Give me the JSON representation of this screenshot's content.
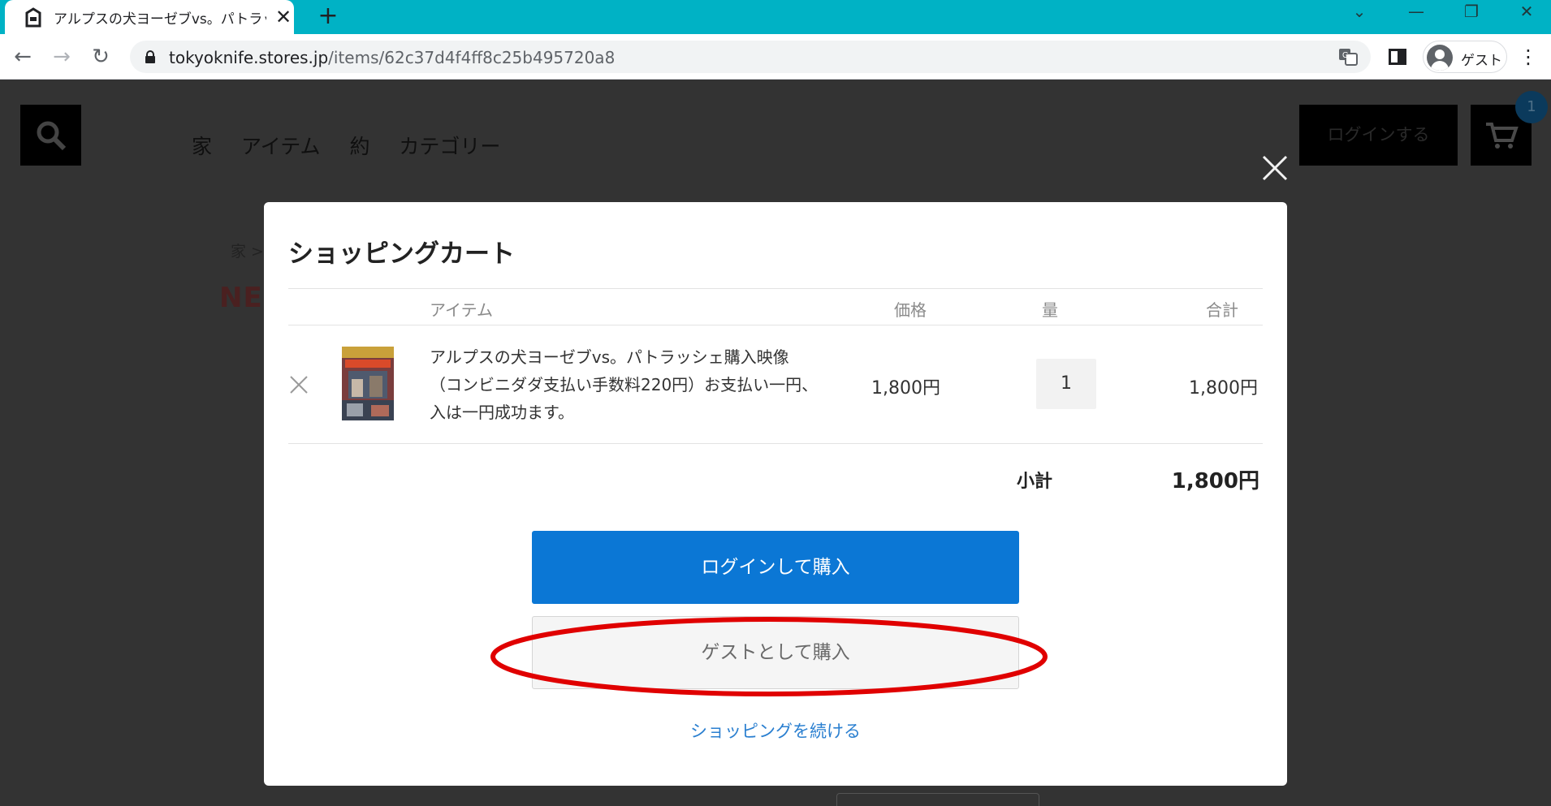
{
  "browser": {
    "tab_title": "アルプスの犬ヨーゼブvs。パトラッシェシ",
    "new_tab": "+",
    "url_domain": "tokyoknife.stores.jp",
    "url_path": "/items/62c37d4f4ff8c25b495720a8",
    "profile_label": "ゲスト",
    "tab_close": "✕"
  },
  "site": {
    "nav": [
      "家",
      "アイテム",
      "約",
      "カテゴリー"
    ],
    "login_label": "ログインする",
    "cart_count": "1",
    "breadcrumb": "家 >",
    "logo_text": "NE"
  },
  "cart": {
    "title": "ショッピングカート",
    "columns": {
      "item": "アイテム",
      "price": "価格",
      "qty": "量",
      "total": "合計"
    },
    "item": {
      "name": "アルプスの犬ヨーゼブvs。パトラッシェ購入映像（コンビニダダ支払い手数料220円）お支払い一円、入は一円成功ます。",
      "price": "1,800円",
      "quantity": "1",
      "line_total": "1,800円"
    },
    "subtotal_label": "小計",
    "subtotal_value": "1,800円",
    "login_buy_label": "ログインして購入",
    "guest_buy_label": "ゲストとして購入",
    "continue_label": "ショッピングを続ける"
  },
  "colors": {
    "accent_tabstrip": "#00b2c5",
    "primary_button": "#0b77d5",
    "link": "#2a7fd0",
    "annotation_red": "#e00000"
  }
}
